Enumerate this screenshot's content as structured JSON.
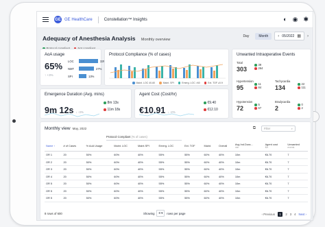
{
  "topbar": {
    "brand": "GE HealthCare",
    "product": "Constellation™ Insights",
    "icons": [
      "menu-icon",
      "ge-logo",
      "dark-mode-icon",
      "account-icon",
      "settings-icon"
    ]
  },
  "header": {
    "title": "Adequacy of Anesthesia Analysis",
    "subtitle": "Monthly overview",
    "legend": [
      {
        "label": "Protocol compliant",
        "color": "#2e9e5b"
      },
      {
        "label": "Not compliant",
        "color": "#e03b3b"
      }
    ],
    "period_tabs": [
      "Day",
      "Month"
    ],
    "active_period": "Month",
    "date_value": "05/2022"
  },
  "asa": {
    "title": "AoA usage",
    "value": "65%",
    "delta": "↑ +3%",
    "rows": [
      {
        "label": "LOC",
        "value": 33,
        "text": "33%"
      },
      {
        "label": "NMT",
        "value": 27,
        "text": "27%"
      },
      {
        "label": "SPI",
        "value": 13,
        "text": "13%"
      }
    ]
  },
  "compliance": {
    "title": "Protocol Compliance (% of cases)",
    "legend": [
      "Maint. LOC 40-60",
      "Maint. SPI",
      "Emerg. LOC >60",
      "Ext. TOF ≥0.9"
    ]
  },
  "unwanted": {
    "title": "Unwanted Intraoperative Events",
    "total_label": "Total",
    "total_value": "303",
    "total_green": "39",
    "total_red": "264",
    "items": [
      {
        "label": "Hypertension",
        "value": "95",
        "green": "11",
        "red": "84"
      },
      {
        "label": "Tachycardia",
        "value": "134",
        "green": "22",
        "red": "111"
      },
      {
        "label": "Hypotension",
        "value": "72",
        "green": "5",
        "red": "67"
      },
      {
        "label": "Bradycardia",
        "value": "2",
        "green": "0",
        "red": "2"
      }
    ]
  },
  "emergence": {
    "title": "Emergence Duration (Avg. mins)",
    "value": "9m 12s",
    "delta": "↓ -3%",
    "green": "8m 13s",
    "red": "11m 18s"
  },
  "agent": {
    "title": "Agent Cost (Cost/hr)",
    "value": "€10.91",
    "delta": "↓ -2%",
    "green": "€9.40",
    "red": "€12.10"
  },
  "table": {
    "title": "Monthly view",
    "date": "May, 2022",
    "filter_placeholder": "Filter",
    "group_label": "Protocol Compliant",
    "group_sub": "(% of cases)",
    "columns": [
      {
        "label": "Name ↑",
        "sub": ""
      },
      {
        "label": "# of Cases",
        "sub": ""
      },
      {
        "label": "% AoA Usage",
        "sub": ""
      },
      {
        "label": "Maint. LOC",
        "sub": ""
      },
      {
        "label": "Maint.SPI",
        "sub": ""
      },
      {
        "label": "Emerg. LOC",
        "sub": ""
      },
      {
        "label": "Ext. TOF",
        "sub": ""
      },
      {
        "label": "Maint.",
        "sub": ""
      },
      {
        "label": "Overall",
        "sub": ""
      },
      {
        "label": "Avg Ind.Dura...",
        "sub": "min"
      },
      {
        "label": "Agent cost",
        "sub": "€/h"
      },
      {
        "label": "Unwanted",
        "sub": "events"
      }
    ],
    "rows": [
      [
        "OR 1",
        "20",
        "50%",
        "60%",
        "40%",
        "55%",
        "55%",
        "60%",
        "40%",
        "10m",
        "€6.70",
        "7"
      ],
      [
        "OR 2",
        "20",
        "50%",
        "60%",
        "40%",
        "55%",
        "55%",
        "60%",
        "40%",
        "10m",
        "€6.70",
        "7"
      ],
      [
        "OR 3",
        "20",
        "50%",
        "60%",
        "40%",
        "55%",
        "55%",
        "60%",
        "40%",
        "10m",
        "€6.70",
        "7"
      ],
      [
        "OR 4",
        "20",
        "50%",
        "60%",
        "40%",
        "55%",
        "55%",
        "60%",
        "40%",
        "10m",
        "€6.70",
        "7"
      ],
      [
        "OR 5",
        "20",
        "50%",
        "60%",
        "40%",
        "55%",
        "55%",
        "60%",
        "40%",
        "10m",
        "€6.70",
        "7"
      ],
      [
        "OR 5",
        "20",
        "50%",
        "60%",
        "40%",
        "55%",
        "55%",
        "60%",
        "40%",
        "10m",
        "€6.70",
        "7"
      ],
      [
        "OR 5",
        "20",
        "50%",
        "60%",
        "40%",
        "55%",
        "55%",
        "60%",
        "40%",
        "10m",
        "€6.70",
        "7"
      ]
    ],
    "footer_count": "8 rows of 600",
    "showing_label": "Showing",
    "page_size": "8",
    "per_page_label": "rows per page",
    "prev_label": "‹ Previous",
    "pages": [
      "1",
      "2",
      "3",
      "4"
    ],
    "active_page": "1",
    "next_label": "Next ›"
  },
  "colors": {
    "accent": "#3b5bdb",
    "bar_blue": "#4a8fd1",
    "green": "#2e9e5b",
    "red": "#e03b3b",
    "orange": "#f0a35c",
    "teal": "#3bb3a8"
  }
}
